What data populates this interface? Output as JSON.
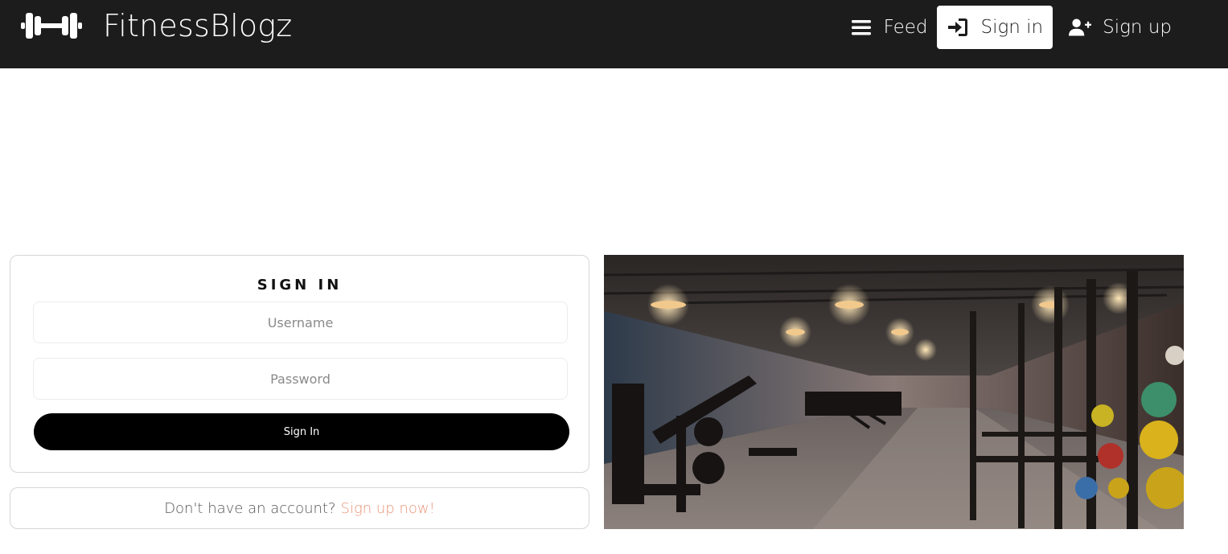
{
  "navbar": {
    "brand": "FitnessBlogz",
    "links": [
      {
        "label": "Feed",
        "icon": "bars-icon"
      },
      {
        "label": "Sign in",
        "icon": "sign-in-icon",
        "active": true
      },
      {
        "label": "Sign up",
        "icon": "user-plus-icon"
      }
    ]
  },
  "signin": {
    "title": "SIGN IN",
    "username_placeholder": "Username",
    "password_placeholder": "Password",
    "button_label": "Sign In"
  },
  "signup_prompt": {
    "text": "Don't have an account?",
    "link_label": "Sign up now!"
  },
  "colors": {
    "navbar_bg": "#1c1c1c",
    "accent_link": "#e8957a",
    "button_bg": "#000000"
  }
}
